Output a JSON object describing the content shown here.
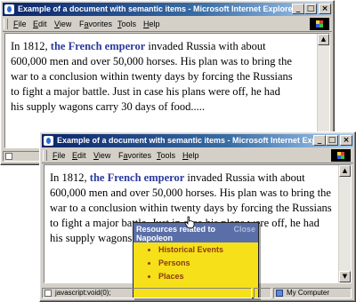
{
  "window_back": {
    "title": "Example of a document with semantic items - Microsoft Internet Explorer",
    "menu": [
      {
        "pre": "",
        "key": "F",
        "post": "ile"
      },
      {
        "pre": "",
        "key": "E",
        "post": "dit"
      },
      {
        "pre": "",
        "key": "V",
        "post": "iew"
      },
      {
        "pre": "F",
        "key": "a",
        "post": "vorites"
      },
      {
        "pre": "",
        "key": "T",
        "post": "ools"
      },
      {
        "pre": "",
        "key": "H",
        "post": "elp"
      }
    ],
    "paragraph_before": "In 1812, ",
    "emphasis": "the French emperor",
    "paragraph_after": " invaded Russia with about 600,000 men and over 50,000 horses. His plan was to bring the war to a conclusion within twenty days by forcing the Russians to fight a major battle. Just in case his plans were off, he had his supply wagons carry 30 days of food....."
  },
  "window_front": {
    "title": "Example of a document with semantic items - Microsoft Internet Explorer",
    "menu": [
      {
        "pre": "",
        "key": "F",
        "post": "ile"
      },
      {
        "pre": "",
        "key": "E",
        "post": "dit"
      },
      {
        "pre": "",
        "key": "V",
        "post": "iew"
      },
      {
        "pre": "F",
        "key": "a",
        "post": "vorites"
      },
      {
        "pre": "",
        "key": "T",
        "post": "ools"
      },
      {
        "pre": "",
        "key": "H",
        "post": "elp"
      }
    ],
    "paragraph_before": "In 1812, ",
    "emphasis": "the French emperor",
    "paragraph_after": " invaded Russia with about 600,000 men and over 50,000 horses. His plan was to bring the war to a conclusion within twenty days by forcing the Russians to fight a major battle. Just in case his plans were off, he had his supply wagons carry 30 days of food.....",
    "status_text": "javascript:void(0);",
    "zone": "My Computer"
  },
  "popup": {
    "title": "Resources related to Napoleon",
    "close_label": "Close",
    "items": [
      "Historical Events",
      "Persons",
      "Places"
    ]
  },
  "colors": {
    "titlebar": "#0a246a",
    "emphasis": "#2b3a9c",
    "popup_bg": "#f5e01a",
    "popup_head": "#5a6fa8",
    "popup_link": "#8b3a14"
  },
  "icons": [
    "ie-page-icon",
    "minimize-icon",
    "maximize-icon",
    "close-icon",
    "windows-throbber-icon",
    "scroll-up-arrow-icon",
    "scroll-down-arrow-icon",
    "page-status-icon",
    "computer-zone-icon",
    "hand-pointer-cursor"
  ]
}
